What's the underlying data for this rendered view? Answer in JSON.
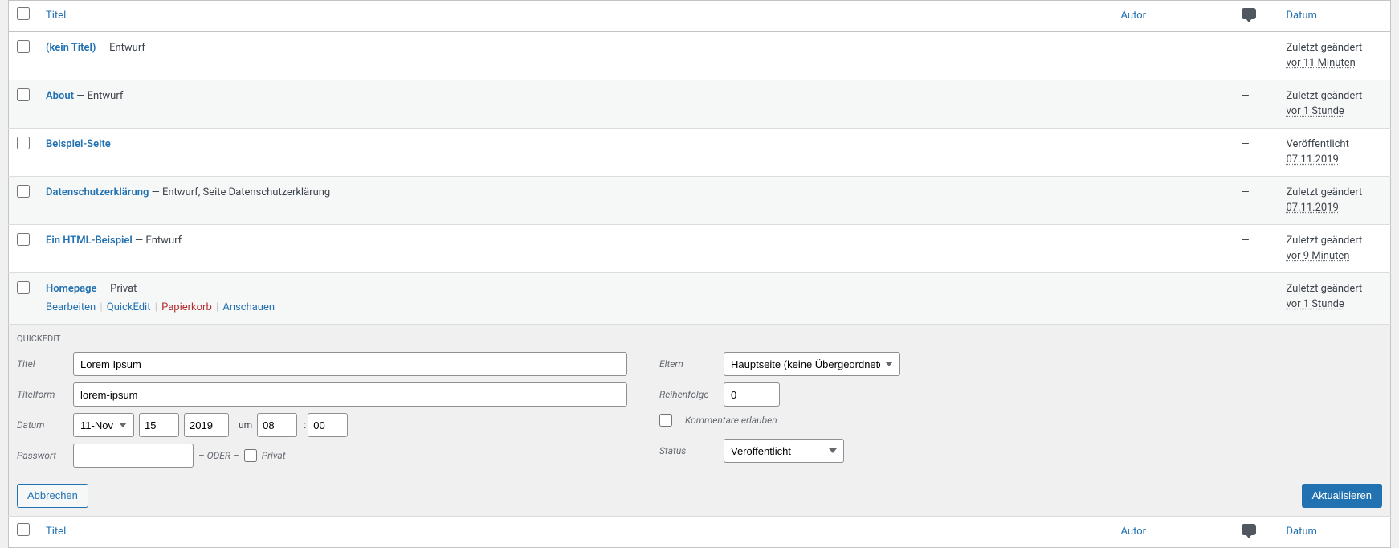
{
  "columns": {
    "title": "Titel",
    "author": "Autor",
    "date": "Datum"
  },
  "rows": [
    {
      "title": "(kein Titel)",
      "state": " — Entwurf",
      "author": "",
      "comments": "—",
      "date_status": "Zuletzt geändert",
      "date_time": "vor 11 Minuten",
      "striped": false
    },
    {
      "title": "About",
      "state": " — Entwurf",
      "author": "",
      "comments": "—",
      "date_status": "Zuletzt geändert",
      "date_time": "vor 1 Stunde",
      "striped": true
    },
    {
      "title": "Beispiel-Seite",
      "state": "",
      "author": "",
      "comments": "—",
      "date_status": "Veröffentlicht",
      "date_time": "07.11.2019",
      "striped": false
    },
    {
      "title": "Datenschutzerklärung",
      "state": " — Entwurf, Seite Datenschutzerklärung",
      "author": "",
      "comments": "—",
      "date_status": "Zuletzt geändert",
      "date_time": "07.11.2019",
      "striped": true
    },
    {
      "title": "Ein HTML-Beispiel",
      "state": " — Entwurf",
      "author": "",
      "comments": "—",
      "date_status": "Zuletzt geändert",
      "date_time": "vor 9 Minuten",
      "striped": false
    },
    {
      "title": "Homepage",
      "state": " — Privat",
      "author": "",
      "comments": "—",
      "date_status": "Zuletzt geändert",
      "date_time": "vor 1 Stunde",
      "striped": true,
      "actions": {
        "edit": "Bearbeiten",
        "quickedit": "QuickEdit",
        "trash": "Papierkorb",
        "view": "Anschauen"
      }
    }
  ],
  "quickedit": {
    "legend": "QUICKEDIT",
    "labels": {
      "title": "Titel",
      "slug": "Titelform",
      "date": "Datum",
      "password": "Passwort",
      "parent": "Eltern",
      "order": "Reihenfolge",
      "status": "Status",
      "um": "um",
      "oder": "– ODER –",
      "private": "Privat",
      "allow_comments": "Kommentare erlauben"
    },
    "values": {
      "title": "Lorem Ipsum",
      "slug": "lorem-ipsum",
      "month": "11-Nov",
      "day": "15",
      "year": "2019",
      "hour": "08",
      "minute": "00",
      "password": "",
      "parent": "Hauptseite (keine Übergeordnete)",
      "order": "0",
      "status": "Veröffentlicht"
    },
    "buttons": {
      "cancel": "Abbrechen",
      "update": "Aktualisieren"
    }
  }
}
